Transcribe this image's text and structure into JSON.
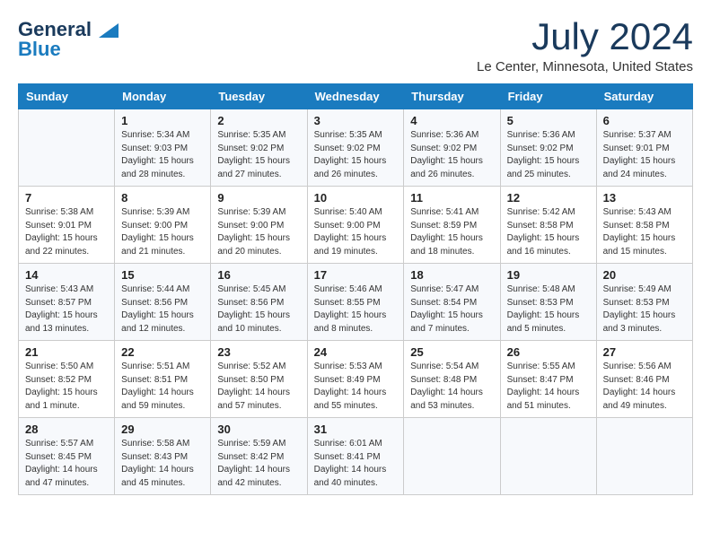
{
  "logo": {
    "line1": "General",
    "line2": "Blue"
  },
  "title": "July 2024",
  "location": "Le Center, Minnesota, United States",
  "weekdays": [
    "Sunday",
    "Monday",
    "Tuesday",
    "Wednesday",
    "Thursday",
    "Friday",
    "Saturday"
  ],
  "weeks": [
    [
      {
        "day": "",
        "info": ""
      },
      {
        "day": "1",
        "info": "Sunrise: 5:34 AM\nSunset: 9:03 PM\nDaylight: 15 hours\nand 28 minutes."
      },
      {
        "day": "2",
        "info": "Sunrise: 5:35 AM\nSunset: 9:02 PM\nDaylight: 15 hours\nand 27 minutes."
      },
      {
        "day": "3",
        "info": "Sunrise: 5:35 AM\nSunset: 9:02 PM\nDaylight: 15 hours\nand 26 minutes."
      },
      {
        "day": "4",
        "info": "Sunrise: 5:36 AM\nSunset: 9:02 PM\nDaylight: 15 hours\nand 26 minutes."
      },
      {
        "day": "5",
        "info": "Sunrise: 5:36 AM\nSunset: 9:02 PM\nDaylight: 15 hours\nand 25 minutes."
      },
      {
        "day": "6",
        "info": "Sunrise: 5:37 AM\nSunset: 9:01 PM\nDaylight: 15 hours\nand 24 minutes."
      }
    ],
    [
      {
        "day": "7",
        "info": "Sunrise: 5:38 AM\nSunset: 9:01 PM\nDaylight: 15 hours\nand 22 minutes."
      },
      {
        "day": "8",
        "info": "Sunrise: 5:39 AM\nSunset: 9:00 PM\nDaylight: 15 hours\nand 21 minutes."
      },
      {
        "day": "9",
        "info": "Sunrise: 5:39 AM\nSunset: 9:00 PM\nDaylight: 15 hours\nand 20 minutes."
      },
      {
        "day": "10",
        "info": "Sunrise: 5:40 AM\nSunset: 9:00 PM\nDaylight: 15 hours\nand 19 minutes."
      },
      {
        "day": "11",
        "info": "Sunrise: 5:41 AM\nSunset: 8:59 PM\nDaylight: 15 hours\nand 18 minutes."
      },
      {
        "day": "12",
        "info": "Sunrise: 5:42 AM\nSunset: 8:58 PM\nDaylight: 15 hours\nand 16 minutes."
      },
      {
        "day": "13",
        "info": "Sunrise: 5:43 AM\nSunset: 8:58 PM\nDaylight: 15 hours\nand 15 minutes."
      }
    ],
    [
      {
        "day": "14",
        "info": "Sunrise: 5:43 AM\nSunset: 8:57 PM\nDaylight: 15 hours\nand 13 minutes."
      },
      {
        "day": "15",
        "info": "Sunrise: 5:44 AM\nSunset: 8:56 PM\nDaylight: 15 hours\nand 12 minutes."
      },
      {
        "day": "16",
        "info": "Sunrise: 5:45 AM\nSunset: 8:56 PM\nDaylight: 15 hours\nand 10 minutes."
      },
      {
        "day": "17",
        "info": "Sunrise: 5:46 AM\nSunset: 8:55 PM\nDaylight: 15 hours\nand 8 minutes."
      },
      {
        "day": "18",
        "info": "Sunrise: 5:47 AM\nSunset: 8:54 PM\nDaylight: 15 hours\nand 7 minutes."
      },
      {
        "day": "19",
        "info": "Sunrise: 5:48 AM\nSunset: 8:53 PM\nDaylight: 15 hours\nand 5 minutes."
      },
      {
        "day": "20",
        "info": "Sunrise: 5:49 AM\nSunset: 8:53 PM\nDaylight: 15 hours\nand 3 minutes."
      }
    ],
    [
      {
        "day": "21",
        "info": "Sunrise: 5:50 AM\nSunset: 8:52 PM\nDaylight: 15 hours\nand 1 minute."
      },
      {
        "day": "22",
        "info": "Sunrise: 5:51 AM\nSunset: 8:51 PM\nDaylight: 14 hours\nand 59 minutes."
      },
      {
        "day": "23",
        "info": "Sunrise: 5:52 AM\nSunset: 8:50 PM\nDaylight: 14 hours\nand 57 minutes."
      },
      {
        "day": "24",
        "info": "Sunrise: 5:53 AM\nSunset: 8:49 PM\nDaylight: 14 hours\nand 55 minutes."
      },
      {
        "day": "25",
        "info": "Sunrise: 5:54 AM\nSunset: 8:48 PM\nDaylight: 14 hours\nand 53 minutes."
      },
      {
        "day": "26",
        "info": "Sunrise: 5:55 AM\nSunset: 8:47 PM\nDaylight: 14 hours\nand 51 minutes."
      },
      {
        "day": "27",
        "info": "Sunrise: 5:56 AM\nSunset: 8:46 PM\nDaylight: 14 hours\nand 49 minutes."
      }
    ],
    [
      {
        "day": "28",
        "info": "Sunrise: 5:57 AM\nSunset: 8:45 PM\nDaylight: 14 hours\nand 47 minutes."
      },
      {
        "day": "29",
        "info": "Sunrise: 5:58 AM\nSunset: 8:43 PM\nDaylight: 14 hours\nand 45 minutes."
      },
      {
        "day": "30",
        "info": "Sunrise: 5:59 AM\nSunset: 8:42 PM\nDaylight: 14 hours\nand 42 minutes."
      },
      {
        "day": "31",
        "info": "Sunrise: 6:01 AM\nSunset: 8:41 PM\nDaylight: 14 hours\nand 40 minutes."
      },
      {
        "day": "",
        "info": ""
      },
      {
        "day": "",
        "info": ""
      },
      {
        "day": "",
        "info": ""
      }
    ]
  ]
}
